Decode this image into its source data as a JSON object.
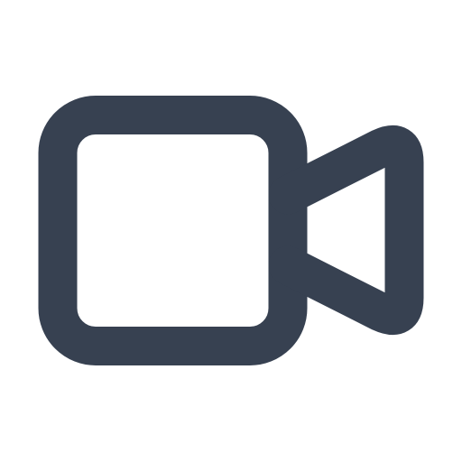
{
  "icon": {
    "name": "video-camera-icon",
    "color": "#374151",
    "background": "#ffffff"
  }
}
